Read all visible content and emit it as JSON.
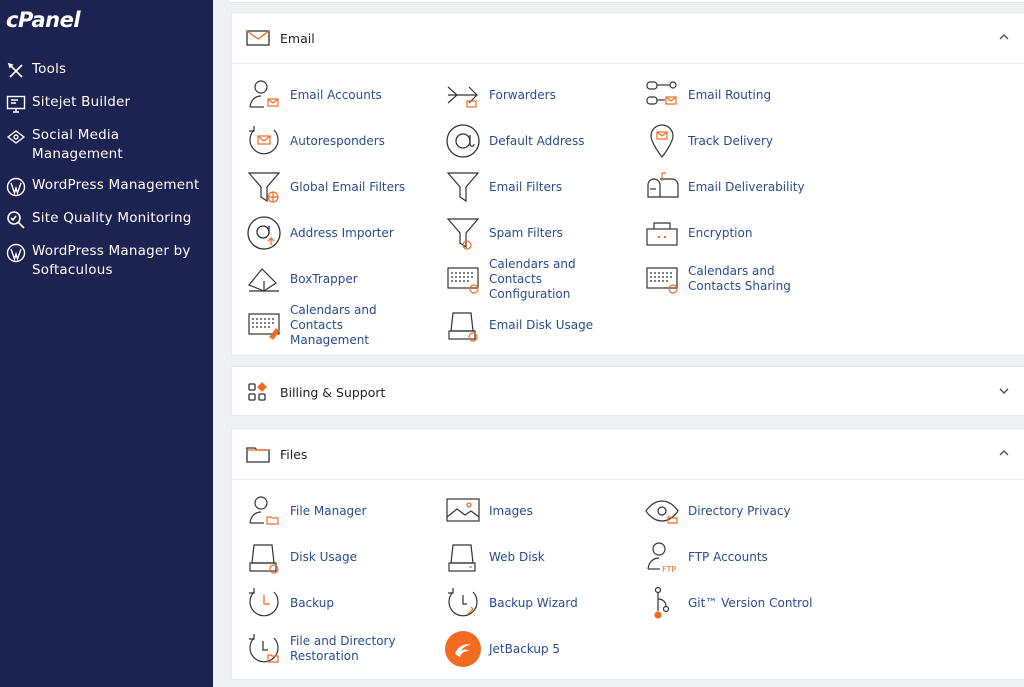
{
  "brand": {
    "logo": "cPanel"
  },
  "sidebar": {
    "items": [
      {
        "label": "Tools",
        "icon": "tools-icon"
      },
      {
        "label": "Sitejet Builder",
        "icon": "monitor-icon"
      },
      {
        "label": "Social Media Management",
        "icon": "social-icon"
      },
      {
        "label": "WordPress Management",
        "icon": "wordpress-icon"
      },
      {
        "label": "Site Quality Monitoring",
        "icon": "magnifier-icon"
      },
      {
        "label": "WordPress Manager by Softaculous",
        "icon": "wordpress-icon"
      }
    ]
  },
  "panels": {
    "email": {
      "title": "Email",
      "expanded": true,
      "items": [
        {
          "label": "Email Accounts",
          "icon": "user-mail-icon"
        },
        {
          "label": "Forwarders",
          "icon": "forward-icon"
        },
        {
          "label": "Email Routing",
          "icon": "routing-icon"
        },
        {
          "label": "Autoresponders",
          "icon": "autoresponder-icon"
        },
        {
          "label": "Default Address",
          "icon": "at-icon"
        },
        {
          "label": "Track Delivery",
          "icon": "location-pin-icon"
        },
        {
          "label": "Global Email Filters",
          "icon": "funnel-globe-icon"
        },
        {
          "label": "Email Filters",
          "icon": "funnel-icon"
        },
        {
          "label": "Email Deliverability",
          "icon": "mailbox-icon"
        },
        {
          "label": "Address Importer",
          "icon": "at-import-icon"
        },
        {
          "label": "Spam Filters",
          "icon": "funnel-clock-icon"
        },
        {
          "label": "Encryption",
          "icon": "lock-box-icon"
        },
        {
          "label": "BoxTrapper",
          "icon": "boxtrapper-icon"
        },
        {
          "label": "Calendars and Contacts Configuration",
          "icon": "calendar-at-icon"
        },
        {
          "label": "Calendars and Contacts Sharing",
          "icon": "calendar-share-icon"
        },
        {
          "label": "Calendars and Contacts Management",
          "icon": "calendar-pen-icon"
        },
        {
          "label": "Email Disk Usage",
          "icon": "disk-clock-icon"
        }
      ]
    },
    "billing": {
      "title": "Billing & Support",
      "expanded": false
    },
    "files": {
      "title": "Files",
      "expanded": true,
      "items": [
        {
          "label": "File Manager",
          "icon": "user-folder-icon"
        },
        {
          "label": "Images",
          "icon": "image-icon"
        },
        {
          "label": "Directory Privacy",
          "icon": "eye-folder-icon"
        },
        {
          "label": "Disk Usage",
          "icon": "disk-clock-icon"
        },
        {
          "label": "Web Disk",
          "icon": "disk-icon"
        },
        {
          "label": "FTP Accounts",
          "icon": "user-ftp-icon"
        },
        {
          "label": "Backup",
          "icon": "backup-clock-icon"
        },
        {
          "label": "Backup Wizard",
          "icon": "backup-wizard-icon"
        },
        {
          "label": "Git™ Version Control",
          "icon": "git-icon"
        },
        {
          "label": "File and Directory Restoration",
          "icon": "restore-folder-icon"
        },
        {
          "label": "JetBackup 5",
          "icon": "jetbackup-icon"
        }
      ]
    }
  },
  "colors": {
    "sidebar": "#1d2351",
    "accent": "#f26b21",
    "link": "#284d8c"
  }
}
